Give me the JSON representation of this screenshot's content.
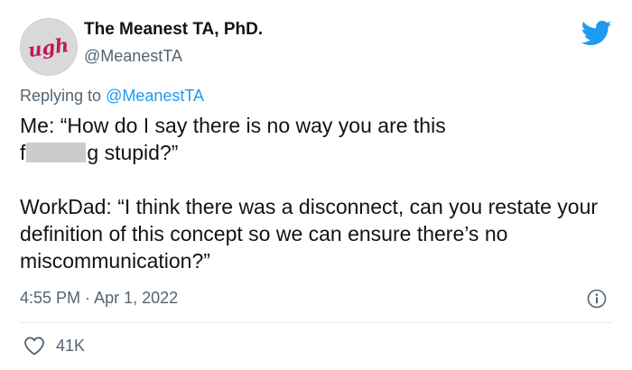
{
  "author": {
    "display_name": "The Meanest TA, PhD.",
    "handle": "@MeanestTA",
    "avatar_text": "ugh"
  },
  "reply": {
    "prefix": "Replying to ",
    "mention": "@MeanestTA"
  },
  "body": {
    "line1": "Me: “How do I say there is no way you are this",
    "line2_start": "f",
    "line2_end": "g stupid?”",
    "para2": "WorkDad: “I think there was a disconnect, can you restate your definition of this concept so we can ensure there’s no miscommunication?”"
  },
  "meta": {
    "time": "4:55 PM",
    "separator": " · ",
    "date": "Apr 1, 2022"
  },
  "engagement": {
    "likes": "41K"
  },
  "icons": {
    "brand": "twitter-bird-icon",
    "info": "info-icon",
    "like": "heart-icon"
  },
  "colors": {
    "brand": "#1d9bf0",
    "secondary_text": "#536471",
    "avatar_text": "#c2185b"
  }
}
